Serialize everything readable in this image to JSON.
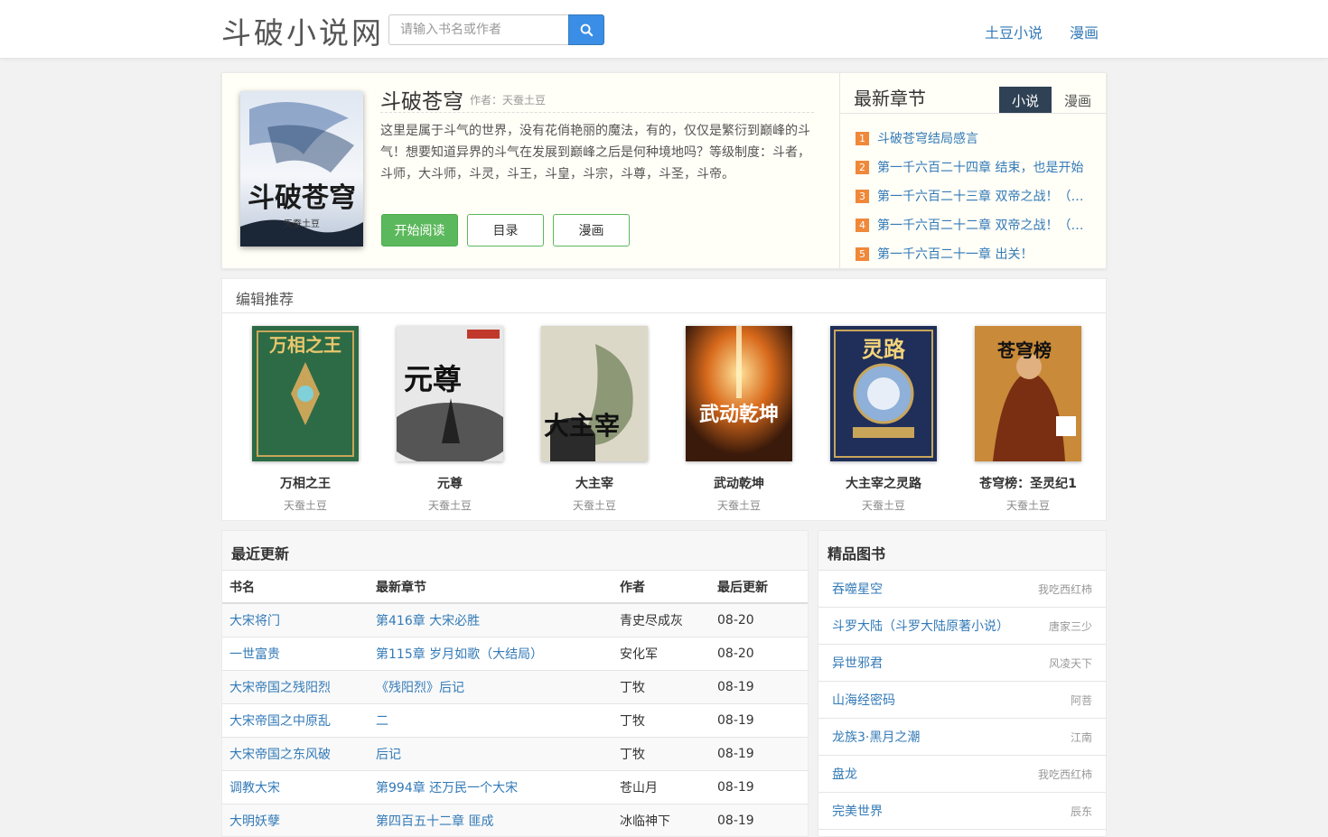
{
  "header": {
    "logo": "斗破小说网",
    "search_placeholder": "请输入书名或作者",
    "nav": [
      "土豆小说",
      "漫画"
    ]
  },
  "book": {
    "title": "斗破苍穹",
    "author": "作者：天蚕土豆",
    "description": "这里是属于斗气的世界，没有花俏艳丽的魔法，有的，仅仅是繁衍到巅峰的斗气！想要知道异界的斗气在发展到巅峰之后是何种境地吗？等级制度：斗者，斗师，大斗师，斗灵，斗王，斗皇，斗宗，斗尊，斗圣，斗帝。",
    "cover_text": "斗破苍穹",
    "cover_sub": "天蚕土豆",
    "buttons": {
      "read": "开始阅读",
      "toc": "目录",
      "comic": "漫画"
    }
  },
  "latest": {
    "title": "最新章节",
    "tabs": [
      "小说",
      "漫画"
    ],
    "chapters": [
      {
        "num": "1",
        "title": "斗破苍穹结局感言"
      },
      {
        "num": "2",
        "title": "第一千六百二十四章 结束，也是开始"
      },
      {
        "num": "3",
        "title": "第一千六百二十三章 双帝之战！（大结局）"
      },
      {
        "num": "4",
        "title": "第一千六百二十二章 双帝之战！（中）"
      },
      {
        "num": "5",
        "title": "第一千六百二十一章 出关！"
      }
    ]
  },
  "recommend": {
    "title": "编辑推荐",
    "items": [
      {
        "name": "万相之王",
        "author": "天蚕土豆",
        "cover": "万相之王"
      },
      {
        "name": "元尊",
        "author": "天蚕土豆",
        "cover": "元尊"
      },
      {
        "name": "大主宰",
        "author": "天蚕土豆",
        "cover": "大主宰"
      },
      {
        "name": "武动乾坤",
        "author": "天蚕土豆",
        "cover": "武动乾坤"
      },
      {
        "name": "大主宰之灵路",
        "author": "天蚕土豆",
        "cover": "灵路"
      },
      {
        "name": "苍穹榜：圣灵纪1",
        "author": "天蚕土豆",
        "cover": "苍穹榜"
      }
    ]
  },
  "updates": {
    "title": "最近更新",
    "columns": [
      "书名",
      "最新章节",
      "作者",
      "最后更新"
    ],
    "rows": [
      [
        "大宋将门",
        "第416章 大宋必胜",
        "青史尽成灰",
        "08-20"
      ],
      [
        "一世富贵",
        "第115章 岁月如歌（大结局）",
        "安化军",
        "08-20"
      ],
      [
        "大宋帝国之残阳烈",
        "《残阳烈》后记",
        "丁牧",
        "08-19"
      ],
      [
        "大宋帝国之中原乱",
        "二",
        "丁牧",
        "08-19"
      ],
      [
        "大宋帝国之东风破",
        "后记",
        "丁牧",
        "08-19"
      ],
      [
        "调教大宋",
        "第994章 还万民一个大宋",
        "苍山月",
        "08-19"
      ],
      [
        "大明妖孽",
        "第四百五十二章 匪成",
        "冰临神下",
        "08-19"
      ]
    ]
  },
  "featured": {
    "title": "精品图书",
    "items": [
      {
        "name": "吞噬星空",
        "author": "我吃西红柿"
      },
      {
        "name": "斗罗大陆（斗罗大陆原著小说）",
        "author": "唐家三少"
      },
      {
        "name": "异世邪君",
        "author": "风凌天下"
      },
      {
        "name": "山海经密码",
        "author": "阿菩"
      },
      {
        "name": "龙族3·黑月之潮",
        "author": "江南"
      },
      {
        "name": "盘龙",
        "author": "我吃西红柿"
      },
      {
        "name": "完美世界",
        "author": "辰东"
      }
    ]
  },
  "colors": {
    "accent": "#3b8ee6",
    "green": "#5cb85c",
    "badge": "#f0883a",
    "tab_active": "#2f4154"
  }
}
